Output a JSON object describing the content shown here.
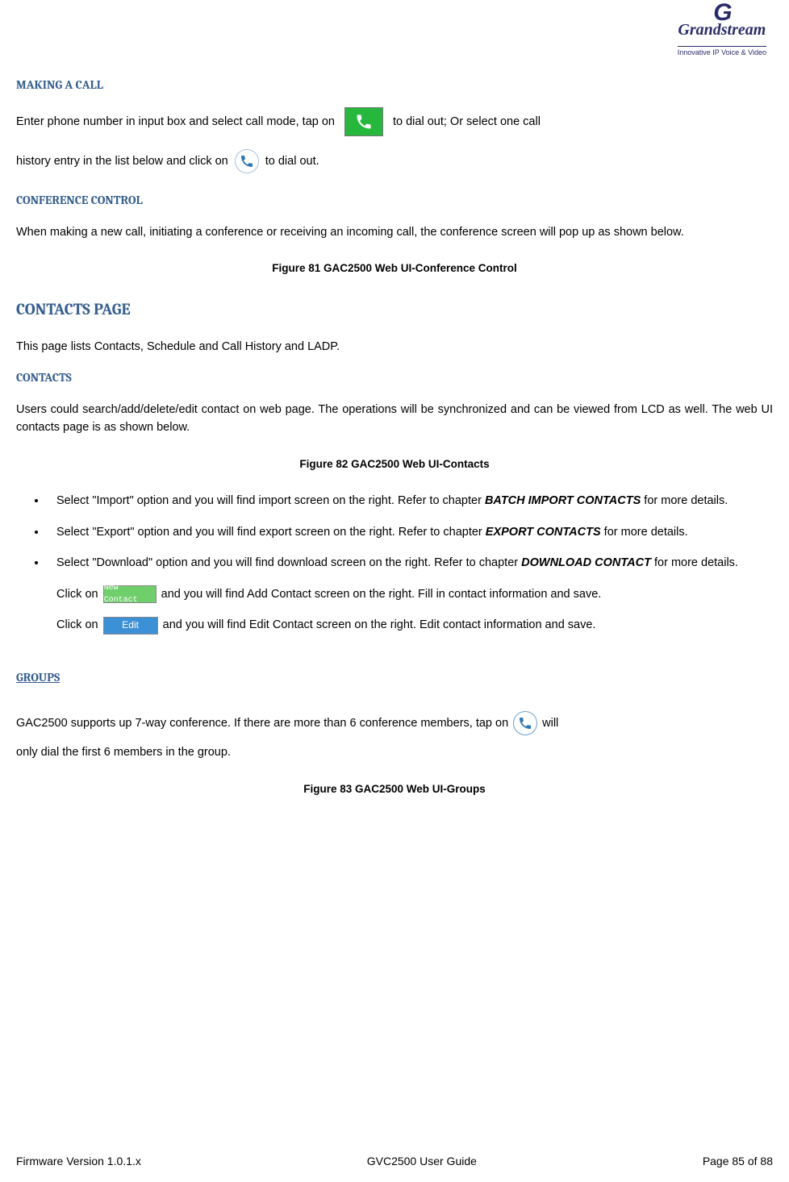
{
  "logo": {
    "brand": "Grandstream",
    "tagline": "Innovative IP Voice & Video"
  },
  "sections": {
    "making_call": {
      "heading": "MAKING A CALL",
      "p1_a": "Enter  phone  number  in  input  box  and  select  call  mode,  tap  on",
      "p1_b": "to  dial  out;  Or  select  one  call",
      "p1_c": "history entry in the list below and click on",
      "p1_d": "to dial out."
    },
    "conf_control": {
      "heading": "CONFERENCE CONTROL",
      "p1": "When making a new call, initiating a conference or receiving an incoming call, the conference screen will pop up as shown below.",
      "caption": "Figure 81 GAC2500 Web UI-Conference Control"
    },
    "contacts_page": {
      "heading": "CONTACTS PAGE",
      "p1": "This page lists Contacts, Schedule and Call History and LADP."
    },
    "contacts": {
      "heading": "CONTACTS",
      "p1": "Users could search/add/delete/edit contact on web page. The operations will be synchronized and can be viewed from LCD as well. The web UI contacts page is as shown below.",
      "caption": "Figure 82 GAC2500 Web UI-Contacts",
      "bullets": [
        {
          "pre": "Select \"Import\" option and you will find import screen on the right. Refer to chapter ",
          "em": "BATCH IMPORT CONTACTS",
          "post": " for more details."
        },
        {
          "pre": "Select  \"Export\"  option  and  you  will  find  export  screen  on  the  right.  Refer  to  chapter  ",
          "em": "EXPORT CONTACTS",
          "post": " for more details."
        },
        {
          "pre": "Select  \"Download\"  option  and  you  will  find  download  screen  on  the  right.  Refer  to  chapter ",
          "em": "DOWNLOAD CONTACT",
          "post": " for more details."
        }
      ],
      "bullet_newcontact_a": "Click on",
      "bullet_newcontact_b": "and you will find Add Contact screen on the right. Fill in contact information and save.",
      "bullet_edit_a": "Click  on",
      "bullet_edit_b": "and  you  will  find  Edit  Contact  screen  on  the  right.  Edit  contact  information  and save.",
      "newcontact_label": "New Contact",
      "edit_label": "Edit"
    },
    "groups": {
      "heading": "GROUPS",
      "p1_a": "GAC2500 supports up 7-way conference. If there are more than 6 conference members, tap on",
      "p1_b": "will",
      "p1_c": "only dial the first 6 members in the group.",
      "caption": "Figure 83 GAC2500 Web UI-Groups"
    }
  },
  "footer": {
    "left": "Firmware Version 1.0.1.x",
    "center": "GVC2500 User Guide",
    "right": "Page 85 of 88"
  }
}
